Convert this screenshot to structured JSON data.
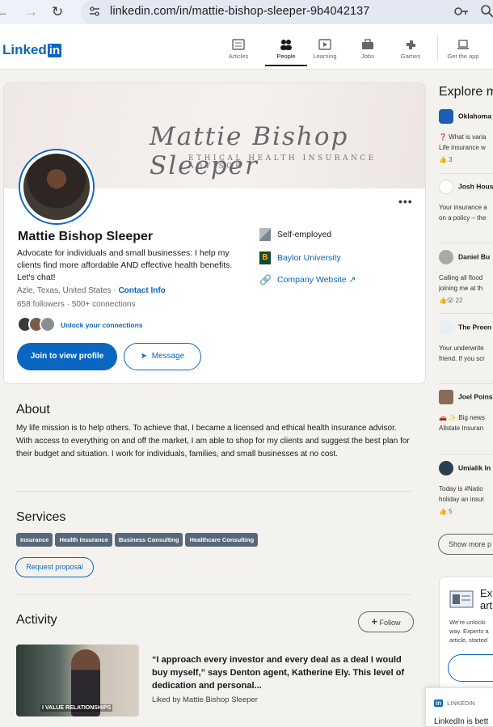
{
  "browser": {
    "url": "linkedin.com/in/mattie-bishop-sleeper-9b4042137"
  },
  "topnav": {
    "logo_text": "Linked",
    "logo_in": "in",
    "items": [
      {
        "label": "Articles",
        "icon": "articles-icon"
      },
      {
        "label": "People",
        "icon": "people-icon"
      },
      {
        "label": "Learning",
        "icon": "learning-icon"
      },
      {
        "label": "Jobs",
        "icon": "jobs-icon"
      },
      {
        "label": "Games",
        "icon": "games-icon"
      },
      {
        "label": "Get the app",
        "icon": "laptop-icon"
      }
    ]
  },
  "profile": {
    "banner_signature": "Mattie Bishop Sleeper",
    "banner_subtitle": "ETHICAL HEALTH INSURANCE ADVISOR",
    "name": "Mattie Bishop Sleeper",
    "headline": "Advocate for individuals and small businesses: I help my clients find more affordable AND effective health benefits. Let's chat!",
    "location": "Azle, Texas, United States",
    "contact_info": "Contact Info",
    "followers": "658 followers",
    "connections": "500+ connections",
    "unlock": "Unlock your connections",
    "view_profile_btn": "Join to view profile",
    "message_btn": "Message",
    "employer": "Self-employed",
    "school": "Baylor University",
    "website": "Company Website"
  },
  "about": {
    "title": "About",
    "text": "My life mission is to help others. To achieve that, I became a licensed and ethical health insurance advisor. With access to everything on and off the market, I am able to shop for my clients and suggest the best plan for their budget and situation. I work for individuals, families, and small businesses at no cost."
  },
  "services": {
    "title": "Services",
    "tags": [
      "Insurance",
      "Health Insurance",
      "Business Consulting",
      "Healthcare Consulting"
    ],
    "request_btn": "Request proposal"
  },
  "activity": {
    "title": "Activity",
    "follow_btn": "Follow",
    "thumb_caption": "I VALUE RELATIONSHIPS",
    "post_text": "“I approach every investor and every deal as a deal I would buy myself,” says Denton agent, Katherine Ely. This level of dedication and personal...",
    "liked_by": "Liked by Mattie Bishop Sleeper"
  },
  "explore": {
    "title": "Explore m",
    "items": [
      {
        "name": "Oklahoma",
        "text": "❓ What is varia Life insurance w",
        "meta": "👍 3"
      },
      {
        "name": "Josh Hous",
        "text": "Your insurance a on a policy – the",
        "meta": ""
      },
      {
        "name": "Daniel Bu",
        "text": "Calling all flood joining me at th",
        "meta": "👍😮 22"
      },
      {
        "name": "The Preen",
        "text": "Your underwrite friend. If you scr",
        "meta": ""
      },
      {
        "name": "Joel Poins",
        "text": "🚗 ✨ Big news Allstate Insuran",
        "meta": ""
      },
      {
        "name": "Umialik In",
        "text": "Today is #Natio holiday an insur",
        "meta": "👍 5"
      }
    ],
    "show_more": "Show more p"
  },
  "expert_card": {
    "title": "Exp art",
    "body": "We're unlocki way. Experts a article, started"
  },
  "toast": {
    "header": "LINKEDIN",
    "body": "LinkedIn is bett"
  }
}
